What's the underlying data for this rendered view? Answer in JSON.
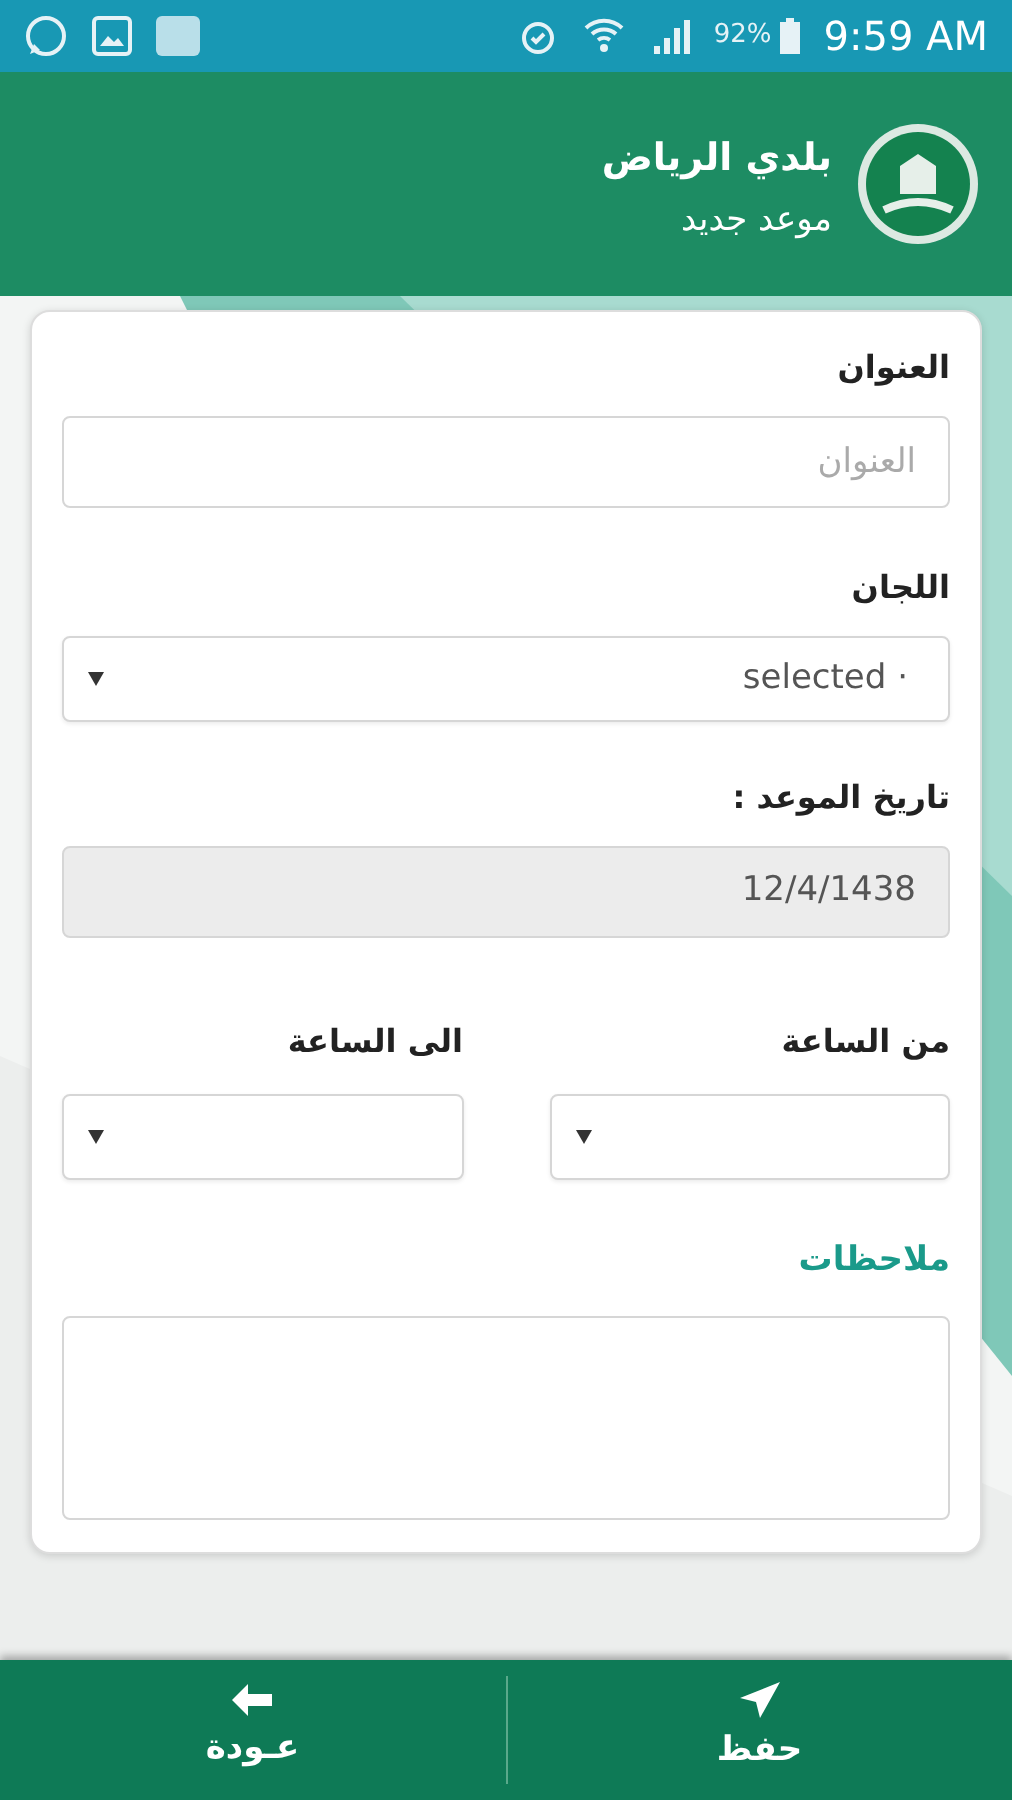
{
  "status_bar": {
    "battery": "92%",
    "time": "9:59 AM"
  },
  "header": {
    "title": "بلدي الرياض",
    "subtitle": "موعد جديد"
  },
  "form": {
    "title_field": {
      "label": "العنوان",
      "placeholder": "العنوان"
    },
    "committees_field": {
      "label": "اللجان",
      "value": "selected ·"
    },
    "date_field": {
      "label": "تاريخ الموعد :",
      "value": "12/4/1438",
      "disabled": true
    },
    "time_from": {
      "label": "من الساعة"
    },
    "time_to": {
      "label": "الى الساعة"
    },
    "notes_field": {
      "label": "ملاحظات"
    }
  },
  "bottom_bar": [
    {
      "kind": "save",
      "label": "حفظ"
    },
    {
      "kind": "back",
      "label": "عـودة"
    }
  ]
}
